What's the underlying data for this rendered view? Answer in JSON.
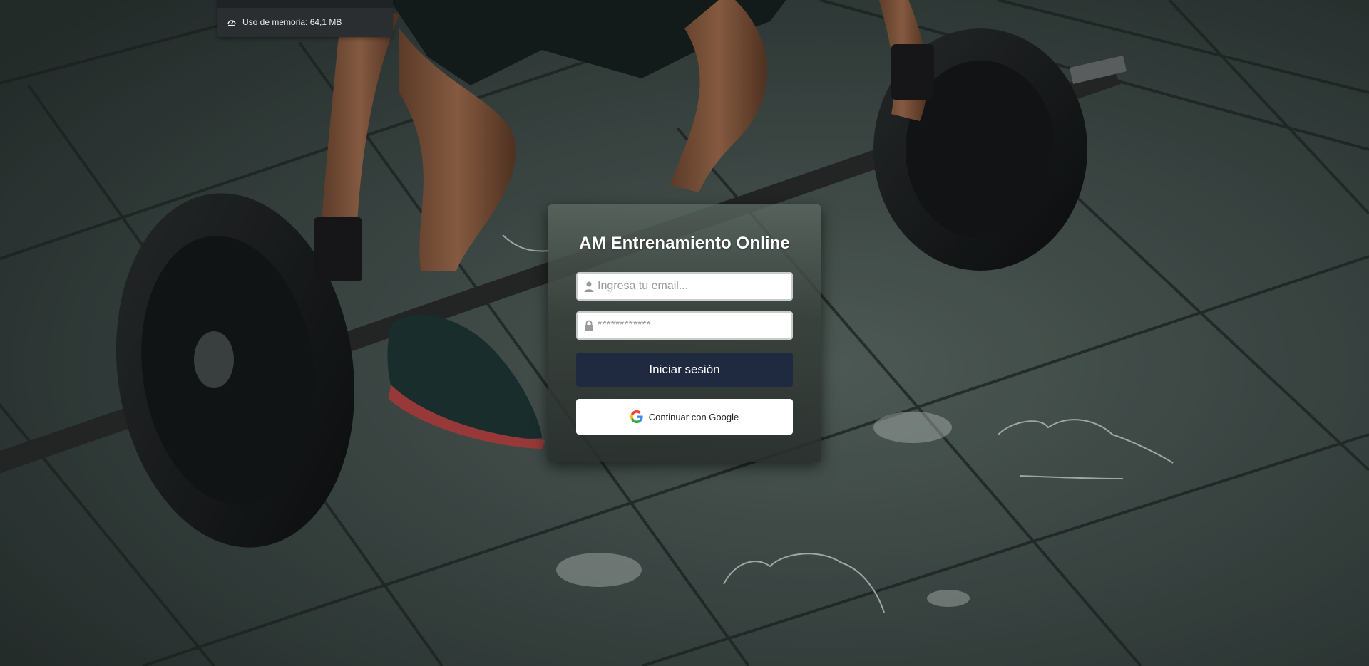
{
  "memory_tooltip": {
    "label": "Uso de memoria: 64,1 MB",
    "icon": "gauge-icon"
  },
  "login": {
    "title": "AM Entrenamiento Online",
    "email_placeholder": "Ingresa tu email...",
    "email_icon": "user-icon",
    "password_placeholder": "************",
    "password_icon": "lock-icon",
    "login_button": "Iniciar sesión",
    "google_button": "Continuar con Google",
    "google_icon": "google-icon"
  },
  "colors": {
    "login_button": "#1f2940",
    "card": "#3a423f",
    "background": "#3c4844"
  },
  "background": {
    "description": "gym-floor-barbell-photo"
  }
}
